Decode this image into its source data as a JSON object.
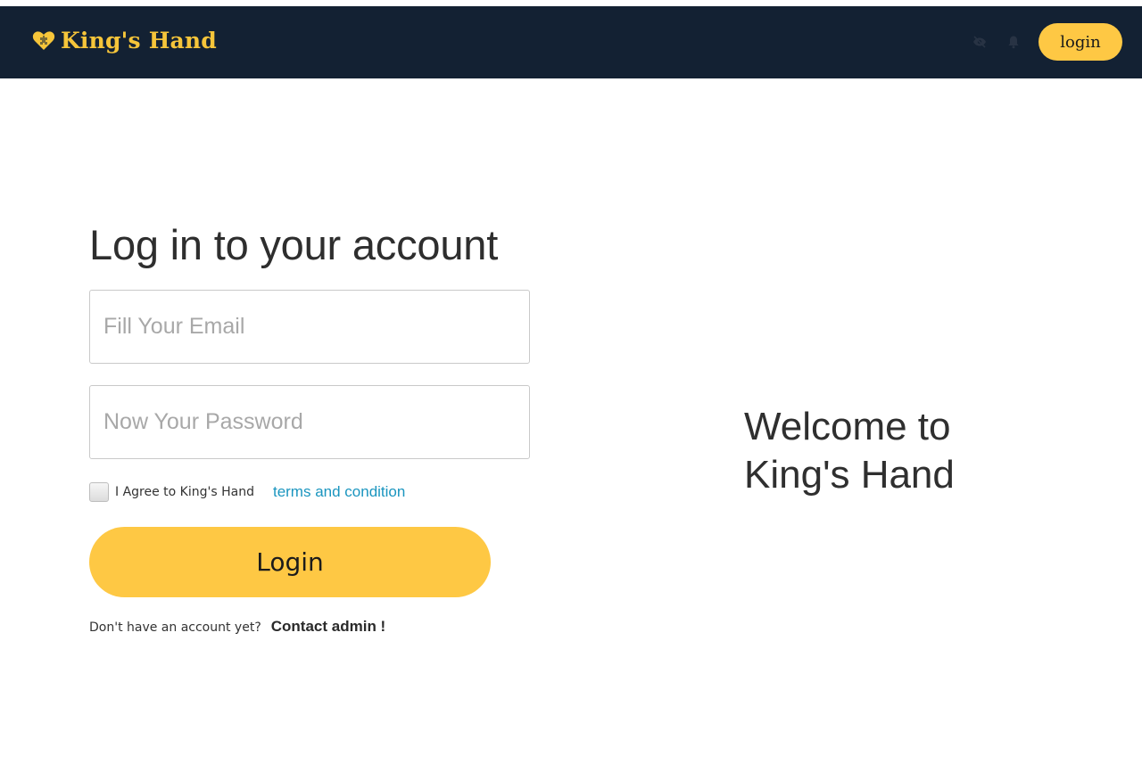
{
  "navbar": {
    "brand_name": "King's Hand",
    "brand_icon": "heart-puzzle-icon",
    "icons": [
      "eye-slash-icon",
      "bell-icon"
    ],
    "login_label": "login",
    "background_color": "#132133",
    "accent_color": "#fec844"
  },
  "form": {
    "title": "Log in to your account",
    "email_placeholder": "Fill Your Email",
    "email_value": "",
    "password_placeholder": "Now Your Password",
    "password_value": "",
    "agree_text": "I Agree to King's Hand",
    "terms_label": "terms and condition",
    "agree_checked": false,
    "login_label": "Login",
    "signup_prompt": "Don't have an account yet?",
    "contact_label": "Contact admin !"
  },
  "welcome": {
    "line1": "Welcome to",
    "line2": "King's Hand"
  }
}
